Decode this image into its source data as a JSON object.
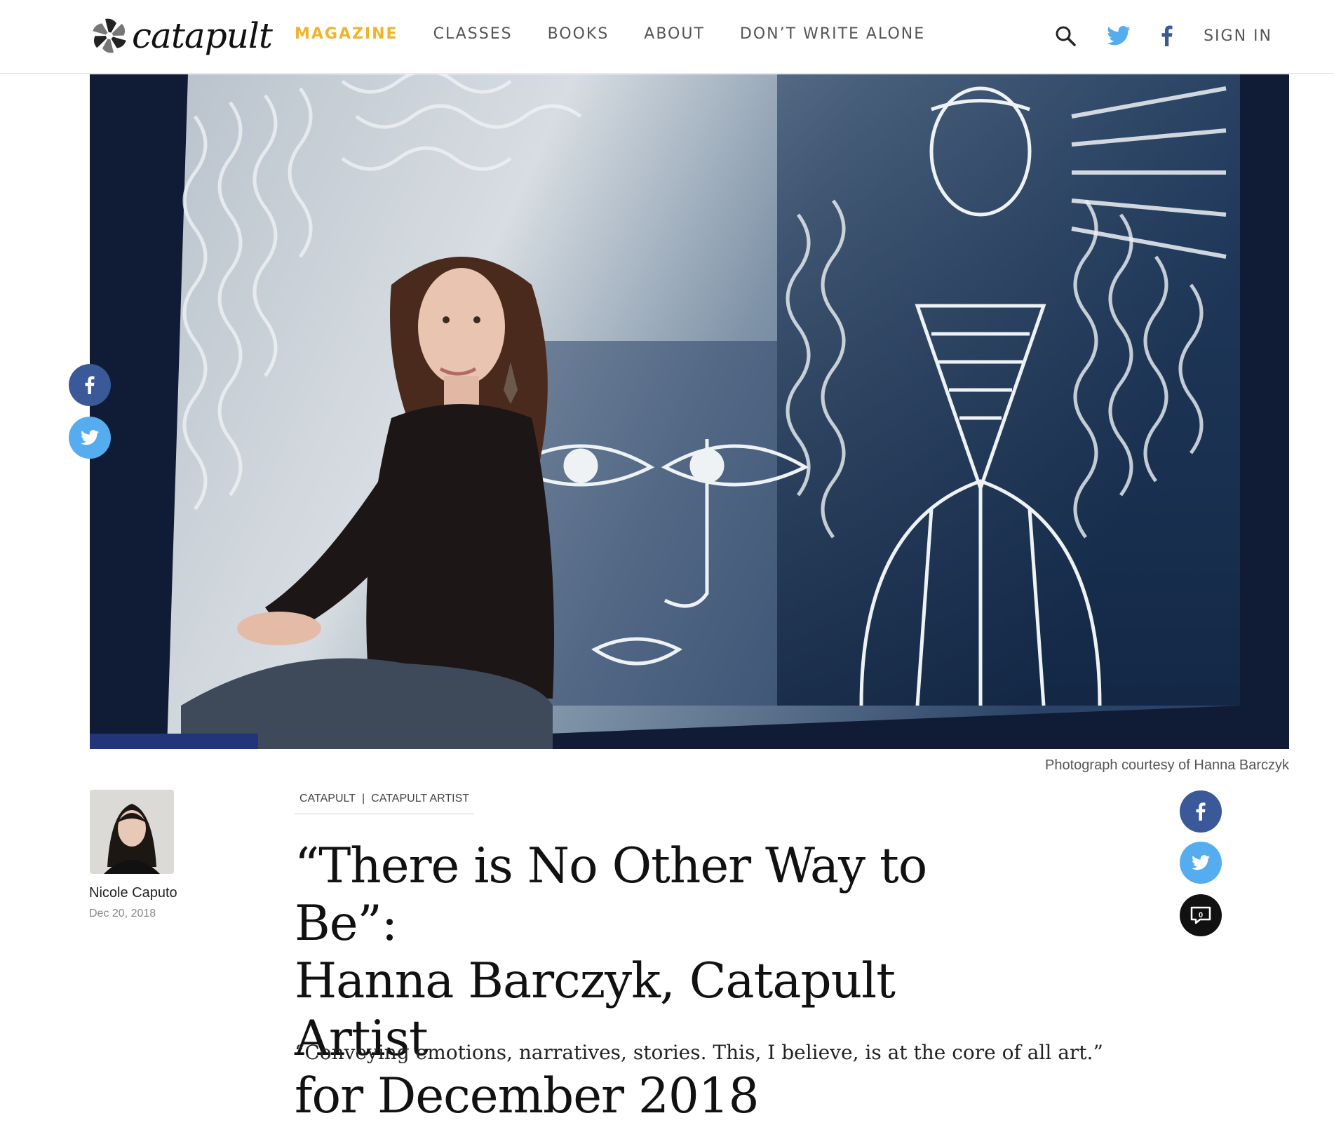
{
  "brand": {
    "name": "catapult",
    "accent": "#f0b429"
  },
  "nav": {
    "items": [
      {
        "label": "MAGAZINE",
        "active": true
      },
      {
        "label": "CLASSES"
      },
      {
        "label": "BOOKS"
      },
      {
        "label": "ABOUT"
      },
      {
        "label": "DON’T WRITE ALONE"
      }
    ],
    "sign_in": "SIGN IN",
    "icons": [
      "search-icon",
      "twitter-icon",
      "facebook-icon"
    ]
  },
  "hero": {
    "caption": "Photograph courtesy of Hanna Barczyk"
  },
  "author": {
    "name": "Nicole Caputo",
    "date": "Dec 20, 2018"
  },
  "article": {
    "tags": [
      "CATAPULT",
      "CATAPULT ARTIST"
    ],
    "title_lines": [
      "“There is No Other Way to Be”:",
      "Hanna Barczyk, Catapult Artist",
      "for December 2018"
    ],
    "dek": "“Conveying emotions, narratives, stories. This, I believe, is at the core of all art.”"
  },
  "share": {
    "comment_count": "0"
  },
  "colors": {
    "facebook": "#3b5998",
    "twitter": "#55acee",
    "comment": "#111111"
  }
}
